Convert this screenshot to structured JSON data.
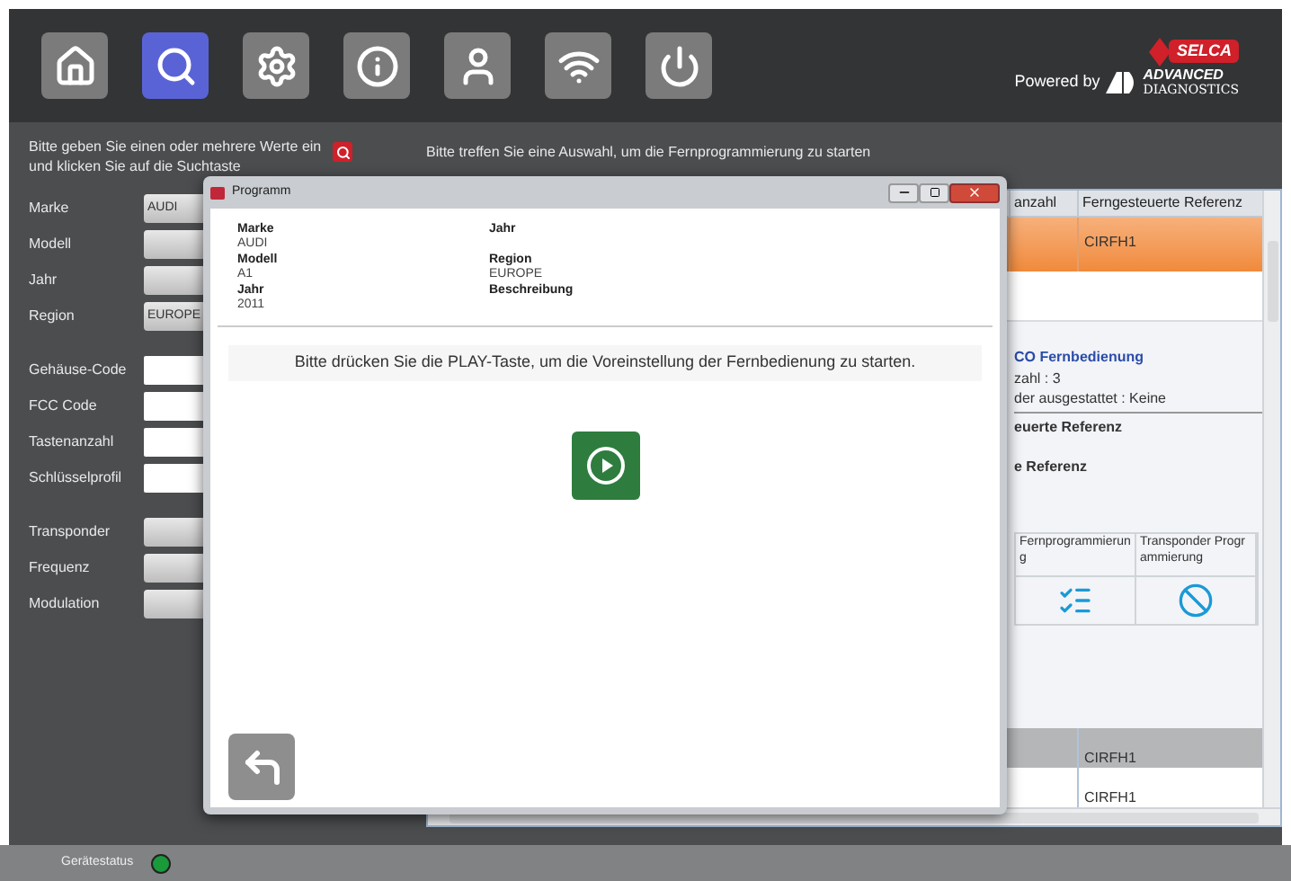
{
  "toolbar": [
    {
      "kind": "home",
      "selected": false
    },
    {
      "kind": "search",
      "selected": true
    },
    {
      "kind": "settings",
      "selected": false
    },
    {
      "kind": "info",
      "selected": false
    },
    {
      "kind": "user",
      "selected": false
    },
    {
      "kind": "wifi",
      "selected": false
    },
    {
      "kind": "power",
      "selected": false
    }
  ],
  "logo": {
    "brand": "SELCA",
    "tagline": "Powered by",
    "partner_top": "ADVANCED",
    "partner_bottom": "DIAGNOSTICS"
  },
  "search_panel": {
    "instructions": "Bitte geben Sie einen oder mehrere Werte ein und klicken Sie auf die Suchtaste",
    "groups": [
      [
        {
          "label": "Marke",
          "kind": "select",
          "value": "AUDI"
        },
        {
          "label": "Modell",
          "kind": "select"
        },
        {
          "label": "Jahr",
          "kind": "select"
        },
        {
          "label": "Region",
          "kind": "select",
          "value": "EUROPE"
        }
      ],
      [
        {
          "label": "Gehäuse-Code",
          "kind": "input"
        },
        {
          "label": "FCC Code",
          "kind": "input"
        },
        {
          "label": "Tastenanzahl",
          "kind": "input"
        },
        {
          "label": "Schlüsselprofil",
          "kind": "input"
        }
      ],
      [
        {
          "label": "Transponder",
          "kind": "select"
        },
        {
          "label": "Frequenz",
          "kind": "select"
        },
        {
          "label": "Modulation",
          "kind": "select"
        }
      ]
    ]
  },
  "results": {
    "instructions": "Bitte treffen Sie eine Auswahl, um die Fernprogrammierung zu starten",
    "columns": [
      "anzahl",
      "Ferngesteuerte Referenz"
    ],
    "rows": [
      {
        "cells": [
          "",
          "CIRFH1"
        ],
        "selected": true
      }
    ],
    "details": {
      "title": "CO Fernbedienung",
      "lines": [
        "zahl : 3",
        "der ausgestattet : Keine"
      ],
      "headings": [
        "euerte Referenz",
        "e Referenz"
      ]
    },
    "actions": [
      {
        "label": "Fernprogrammierung",
        "kind": "checklist"
      },
      {
        "label": "Transponder Programmierung",
        "kind": "blocked"
      }
    ],
    "bottom_rows": [
      {
        "value": "CIRFH1",
        "selected": true
      },
      {
        "value": "CIRFH1",
        "selected": false
      }
    ]
  },
  "dialog": {
    "title": "Programm",
    "info_left": [
      {
        "label": "Marke",
        "value": "AUDI"
      },
      {
        "label": "Modell",
        "value": "A1"
      },
      {
        "label": "Jahr",
        "value": "2011"
      }
    ],
    "info_right": [
      {
        "label": "Jahr"
      },
      {
        "label": "Region",
        "value": "EUROPE"
      },
      {
        "label": "Beschreibung"
      }
    ],
    "message": "Bitte drücken Sie die PLAY-Taste, um die Voreinstellung der Fernbedienung zu starten."
  },
  "status_bar": {
    "label": "Gerätestatus",
    "connected": true
  }
}
